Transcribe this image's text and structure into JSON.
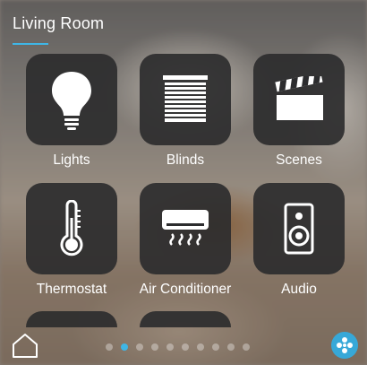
{
  "header": {
    "title": "Living Room"
  },
  "tiles": [
    {
      "label": "Lights",
      "icon": "lightbulb-icon"
    },
    {
      "label": "Blinds",
      "icon": "blinds-icon"
    },
    {
      "label": "Scenes",
      "icon": "clapperboard-icon"
    },
    {
      "label": "Thermostat",
      "icon": "thermometer-icon"
    },
    {
      "label": "Air Conditioner",
      "icon": "air-conditioner-icon"
    },
    {
      "label": "Audio",
      "icon": "speaker-icon"
    }
  ],
  "pagination": {
    "page_count": 10,
    "active_index": 1
  },
  "colors": {
    "accent": "#3fb6e6",
    "tile": "#2c2c2e",
    "menu_button": "#37a8d8"
  }
}
